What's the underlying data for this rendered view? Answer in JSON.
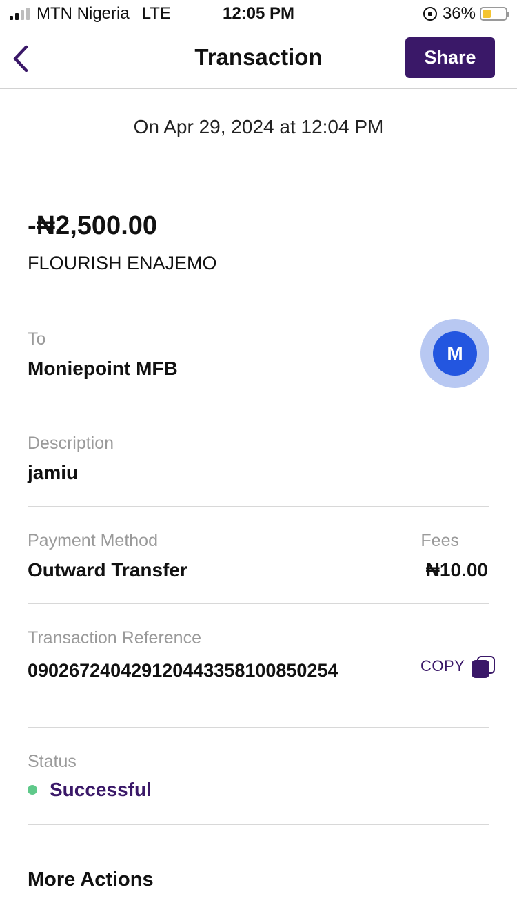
{
  "status_bar": {
    "carrier": "MTN Nigeria",
    "network": "LTE",
    "time": "12:05 PM",
    "battery": "36%",
    "battery_level": 0.36,
    "signal_bars_active": 2,
    "signal_bars_total": 4
  },
  "nav": {
    "title": "Transaction",
    "share_label": "Share",
    "back_icon": "chevron-left-icon"
  },
  "transaction": {
    "date_line": "On Apr 29, 2024 at 12:04 PM",
    "amount": "-₦2,500.00",
    "recipient_name": "FLOURISH ENAJEMO",
    "to_label": "To",
    "bank_name": "Moniepoint MFB",
    "bank_initial": "M",
    "description_label": "Description",
    "description": "jamiu",
    "payment_method_label": "Payment Method",
    "payment_method": "Outward Transfer",
    "fees_label": "Fees",
    "fees": "₦10.00",
    "reference_label": "Transaction Reference",
    "reference": "090267240429120443358100850254",
    "copy_label": "COPY",
    "status_label": "Status",
    "status": "Successful"
  },
  "more_actions": {
    "title": "More Actions"
  },
  "colors": {
    "brand_purple": "#3a1868",
    "success_green": "#5fc98a",
    "bank_blue": "#2356e0",
    "bank_blue_light": "#b8c8f2"
  }
}
